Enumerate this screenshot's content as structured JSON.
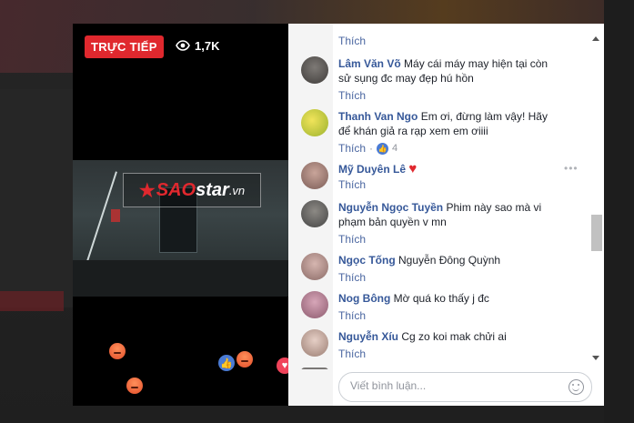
{
  "video": {
    "live_label": "TRỰC TIẾP",
    "view_count": "1,7K",
    "watermark": {
      "brand_red": "SAO",
      "brand_white": "star",
      "domain": ".vn"
    }
  },
  "comments": [
    {
      "name": "",
      "text": "",
      "like_label": "Thích"
    },
    {
      "name": "Lâm Văn Võ",
      "text": "Máy cái máy may hiện tại còn sử sụng đc may đẹp hú hồn",
      "like_label": "Thích"
    },
    {
      "name": "Thanh Van Ngo",
      "text": "Em ơi, đừng làm vậy! Hãy để khán giả ra rạp xem em ơiiii",
      "like_label": "Thích",
      "reaction_count": "4"
    },
    {
      "name": "Mỹ Duyên Lê",
      "text": "",
      "like_label": "Thích",
      "emoji": "♥"
    },
    {
      "name": "Nguyễn Ngọc Tuyền",
      "text": "Phim này sao mà vi phạm bản quyền v mn",
      "like_label": "Thích"
    },
    {
      "name": "Ngọc Tống",
      "text": "Nguyễn Đông Quỳnh",
      "like_label": "Thích"
    },
    {
      "name": "Nog Bông",
      "text": "Mờ quá ko thấy j đc",
      "like_label": "Thích"
    },
    {
      "name": "Nguyễn Xíu",
      "text": "Cg zo koi mak chửi ai",
      "like_label": "Thích"
    }
  ],
  "comment_input": {
    "placeholder": "Viết bình luận..."
  },
  "colors": {
    "live_red": "#e0282e",
    "name_blue": "#365899",
    "link_blue": "#4b67a1"
  }
}
